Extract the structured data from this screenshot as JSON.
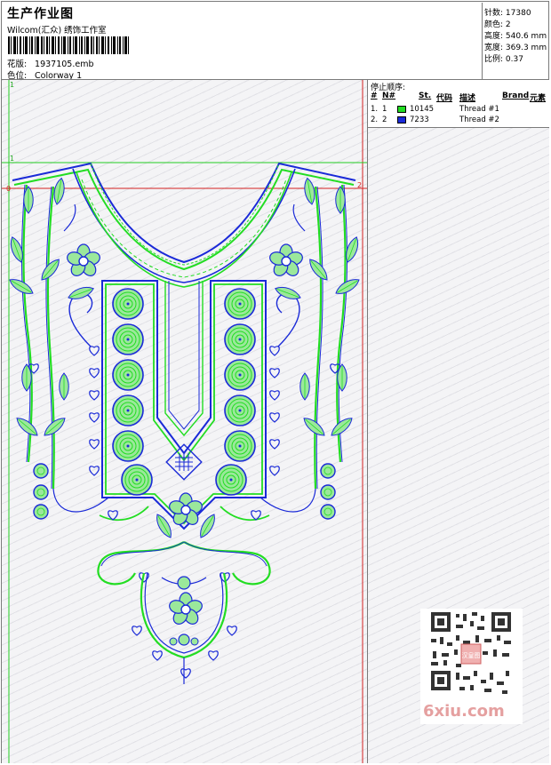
{
  "header": {
    "title": "生产作业图",
    "company": "Wilcom(汇众) 绣饰工作室",
    "design_label": "花版:",
    "design_file": "1937105.emb",
    "colorway_label": "色位:",
    "colorway": "Colorway 1"
  },
  "stats": [
    {
      "label": "针数:",
      "value": "17380"
    },
    {
      "label": "颜色:",
      "value": "2"
    },
    {
      "label": "高度:",
      "value": "540.6 mm"
    },
    {
      "label": "宽度:",
      "value": "369.3 mm"
    },
    {
      "label": "比例:",
      "value": "0.37"
    }
  ],
  "stop_panel": {
    "title": "停止顺序:",
    "columns": {
      "num": "#",
      "needle": "N#",
      "st": "St.",
      "code": "代码",
      "desc": "描述",
      "brand": "Brand",
      "elem": "元素"
    },
    "rows": [
      {
        "num": "1.",
        "needle": "1",
        "code": "10145",
        "desc": "Thread #1",
        "color": "#22dd22"
      },
      {
        "num": "2.",
        "needle": "2",
        "code": "7233",
        "desc": "Thread #2",
        "color": "#1a2ad8"
      }
    ]
  },
  "canvas": {
    "marker_top": "1",
    "marker_left": "1",
    "marker_h1": "0",
    "marker_h2": "2"
  },
  "watermark": {
    "text": "6xiu.com",
    "stamp": "汉皇图"
  },
  "colors": {
    "thread1": "#22dd22",
    "thread2": "#1a2ad8",
    "guide_red": "#d42020",
    "guide_green": "#22cc22"
  }
}
